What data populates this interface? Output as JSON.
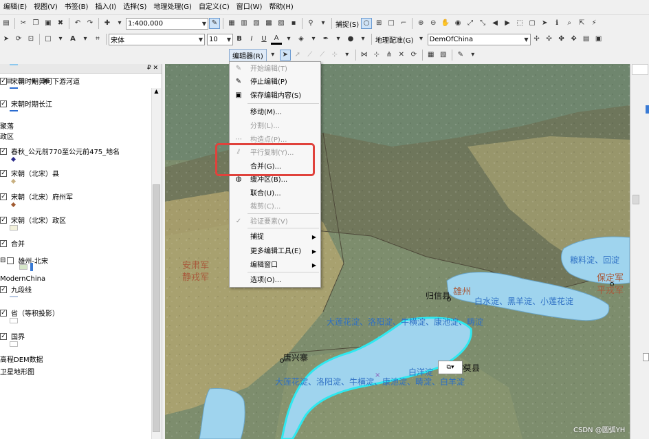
{
  "menubar": [
    "编辑(E)",
    "视图(V)",
    "书签(B)",
    "插入(I)",
    "选择(S)",
    "地理处理(G)",
    "自定义(C)",
    "窗口(W)",
    "帮助(H)"
  ],
  "toolbar": {
    "scale": "1:400,000",
    "snap_label": "捕捉(S)",
    "font_name": "宋体",
    "font_size": "10",
    "bold": "B",
    "italic": "I",
    "underline": "U",
    "font_color": "A",
    "georef_label": "地理配准(G)",
    "georef_layer": "DemOfChina",
    "editor_label": "编辑器(R)"
  },
  "toc": {
    "pin": "₽ ✕",
    "layers": [
      {
        "label": "宋朝时期 1048-1069京杭运河",
        "checked": true
      },
      {
        "label": "宋朝（北宋）漳沱河",
        "checked": true
      },
      {
        "label": "宋朝时期黄河下游河道",
        "checked": true
      },
      {
        "label": "宋朝时期长江",
        "checked": true
      },
      {
        "label": "聚落",
        "checked": null
      },
      {
        "label": "政区",
        "checked": null
      },
      {
        "label": "春秋_公元前770至公元前475_地名",
        "checked": true
      },
      {
        "label": "宋朝（北宋）县",
        "checked": true
      },
      {
        "label": "宋朝（北宋）府州军",
        "checked": true
      },
      {
        "label": "宋朝（北宋）政区",
        "checked": true
      },
      {
        "label": "合并",
        "checked": true
      },
      {
        "label": "雄州-北宋",
        "checked": false
      },
      {
        "label": "ModernChina",
        "checked": null
      },
      {
        "label": "九段线",
        "checked": true
      },
      {
        "label": "省（等积投影）",
        "checked": true
      },
      {
        "label": "国界",
        "checked": true
      },
      {
        "label": "高程DEM数据",
        "checked": null
      },
      {
        "label": "卫星地形图",
        "checked": null
      }
    ]
  },
  "editor_menu": [
    {
      "label": "开始编辑(T)",
      "disabled": true,
      "icon": "pencil-icon"
    },
    {
      "label": "停止编辑(P)",
      "disabled": false,
      "icon": "stop-edit-icon"
    },
    {
      "label": "保存编辑内容(S)",
      "disabled": false,
      "icon": "save-edits-icon"
    },
    {
      "label": "移动(M)...",
      "disabled": false,
      "icon": ""
    },
    {
      "label": "分割(L)...",
      "disabled": true,
      "icon": ""
    },
    {
      "label": "构造点(P)...",
      "disabled": true,
      "icon": "construct-points-icon"
    },
    {
      "label": "平行复制(Y)...",
      "disabled": true,
      "icon": "copy-parallel-icon"
    },
    {
      "label": "合并(G)...",
      "disabled": false,
      "icon": ""
    },
    {
      "label": "缓冲区(B)...",
      "disabled": false,
      "icon": "buffer-icon"
    },
    {
      "label": "联合(U)...",
      "disabled": false,
      "icon": ""
    },
    {
      "label": "裁剪(C)...",
      "disabled": true,
      "icon": ""
    },
    {
      "label": "验证要素(V)",
      "disabled": true,
      "icon": "validate-icon"
    },
    {
      "label": "捕捉",
      "disabled": false,
      "icon": "",
      "submenu": true
    },
    {
      "label": "更多编辑工具(E)",
      "disabled": false,
      "icon": "",
      "submenu": true
    },
    {
      "label": "编辑窗口",
      "disabled": false,
      "icon": "",
      "submenu": true
    },
    {
      "label": "选项(O)...",
      "disabled": false,
      "icon": ""
    }
  ],
  "map_labels": {
    "anshun": "安肃军",
    "jingrong": "静戎军",
    "guixin": "归信县",
    "xiongzhou": "雄州",
    "baishui": "白水淀、黑羊淀、小莲花淀",
    "liangliao": "粮料淀、回淀",
    "baoding": "保定军",
    "pingrong": "平戎军",
    "dalian1": "大莲花淀、洛阳淀、牛横淀、康池淀、畴淀",
    "tangxing": "唐兴寨",
    "baiyang": "白洋淀",
    "mo": "莫县",
    "dalian2": "大莲花淀、洛阳淀、牛横淀、康池淀、畴淀、白羊淀"
  },
  "watermark": "CSDN @圆弧YH",
  "colors": {
    "highlight": "#e0423c",
    "lake_fill": "#9fd4ee",
    "selected_outline": "#2ee8f0"
  }
}
